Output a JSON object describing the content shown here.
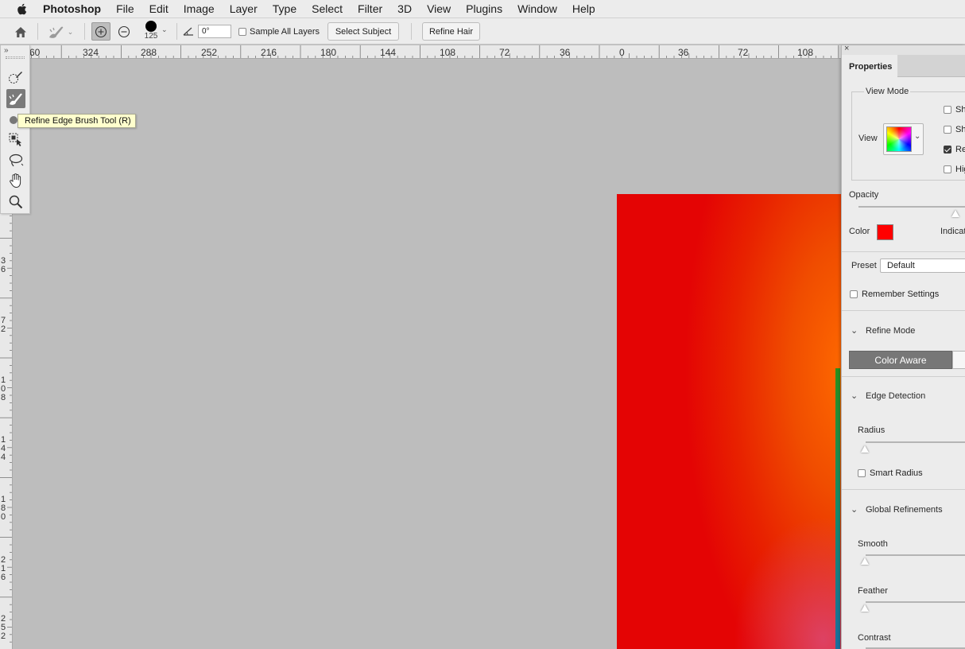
{
  "menubar": {
    "app_name": "Photoshop",
    "items": [
      "File",
      "Edit",
      "Image",
      "Layer",
      "Type",
      "Select",
      "Filter",
      "3D",
      "View",
      "Plugins",
      "Window",
      "Help"
    ]
  },
  "options_bar": {
    "brush_size": "125",
    "angle_value": "0°",
    "sample_all_layers": "Sample All Layers",
    "sample_all_layers_checked": false,
    "select_subject": "Select Subject",
    "refine_hair": "Refine Hair"
  },
  "rulers": {
    "horizontal": [
      "60",
      "324",
      "288",
      "252",
      "216",
      "180",
      "144",
      "108",
      "72",
      "36",
      "0",
      "36",
      "72",
      "108"
    ],
    "vertical": [
      "3\n6",
      "7\n2",
      "1\n0\n8",
      "1\n4\n4",
      "1\n8\n0",
      "2\n1\n6",
      "2\n5\n2"
    ]
  },
  "toolbox": {
    "tools": [
      "quick-selection-icon",
      "refine-edge-brush-icon",
      "brush-icon",
      "object-selection-icon",
      "lasso-icon",
      "hand-icon",
      "zoom-icon"
    ],
    "active": "refine-edge-brush-icon"
  },
  "tooltip": {
    "text": "Refine Edge Brush Tool (R)"
  },
  "properties": {
    "tab_label": "Properties",
    "view_mode": {
      "title": "View Mode",
      "view_label": "View",
      "options": [
        {
          "label": "Sho",
          "checked": false
        },
        {
          "label": "Sho",
          "checked": false
        },
        {
          "label": "Rea",
          "checked": true
        },
        {
          "label": "Hig",
          "checked": false
        }
      ]
    },
    "opacity_label": "Opacity",
    "opacity_percent": 90,
    "color_label": "Color",
    "indicates_label": "Indicat",
    "overlay_color": "#ff0000",
    "preset_label": "Preset",
    "preset_value": "Default",
    "remember_settings": "Remember Settings",
    "remember_settings_checked": false,
    "refine_mode": {
      "title": "Refine Mode",
      "active_button": "Color Aware"
    },
    "edge_detection": {
      "title": "Edge Detection",
      "radius_label": "Radius",
      "smart_radius": "Smart Radius",
      "smart_radius_checked": false
    },
    "global_refinements": {
      "title": "Global Refinements",
      "smooth_label": "Smooth",
      "feather_label": "Feather",
      "contrast_label": "Contrast"
    }
  },
  "colors": {
    "chrome_bg": "#ececec",
    "canvas_bg": "#bdbdbd",
    "image_red": "#e40404",
    "image_orange": "#ff6a00",
    "tooltip_bg": "#ffffcd"
  }
}
